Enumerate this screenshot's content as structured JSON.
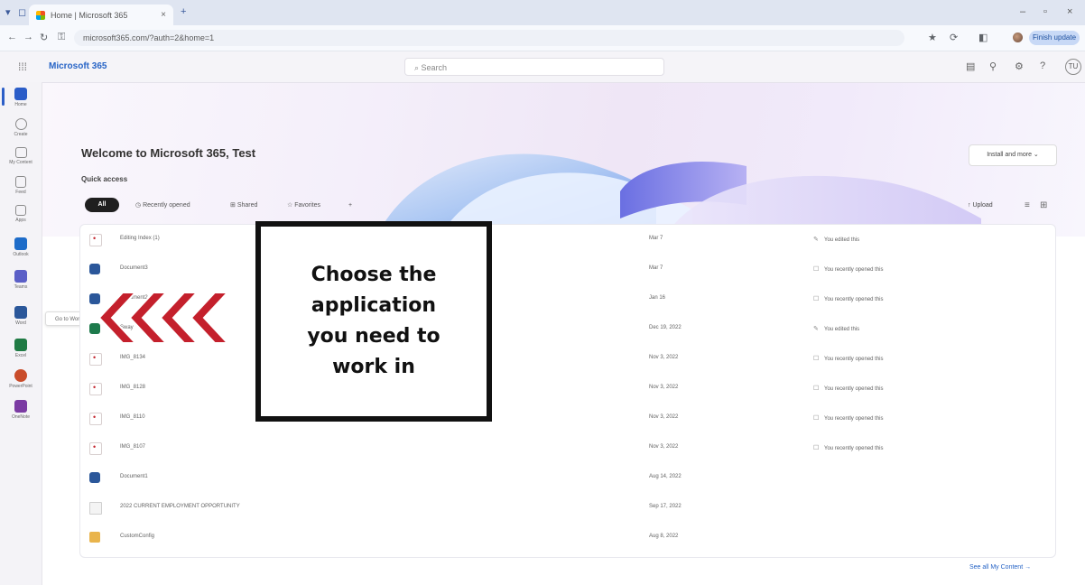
{
  "browser": {
    "tab_title": "Home | Microsoft 365",
    "tab_close": "×",
    "new_tab": "+",
    "url": "microsoft365.com/?auth=2&home=1",
    "update_label": "Finish update",
    "window_controls": [
      "–",
      "▫",
      "×"
    ]
  },
  "header": {
    "app_name": "Microsoft 365",
    "search_placeholder": "Search",
    "avatar_initials": "TU"
  },
  "rail": {
    "items": [
      {
        "label": "Home",
        "color": "#2b5dc8"
      },
      {
        "label": "Create",
        "color": "#7a7a7a"
      },
      {
        "label": "My Content",
        "color": "#7a7a7a"
      },
      {
        "label": "Feed",
        "color": "#7a7a7a"
      },
      {
        "label": "Apps",
        "color": "#7a7a7a"
      },
      {
        "label": "Outlook",
        "color": "#1d6cc9"
      },
      {
        "label": "Teams",
        "color": "#5b5fc7"
      },
      {
        "label": "Word",
        "color": "#2b579a"
      },
      {
        "label": "Excel",
        "color": "#1f7a44"
      },
      {
        "label": "PowerPoint",
        "color": "#c94c2a"
      },
      {
        "label": "OneNote",
        "color": "#7b3ba3"
      }
    ],
    "tooltip": "Go to Word"
  },
  "hero": {
    "welcome": "Welcome to Microsoft 365, Test",
    "install_label": "Install and more ⌄",
    "quick_access": "Quick access"
  },
  "filters": {
    "all": "All",
    "recent": "Recently opened",
    "shared": "Shared",
    "favorites": "Favorites",
    "more": "+",
    "upload": "Upload"
  },
  "files": [
    {
      "name": "Editing Index (1)",
      "date": "Mar 7",
      "activity": "You edited this",
      "type": "pdf",
      "act_icon": "✎"
    },
    {
      "name": "Document3",
      "date": "Mar 7",
      "activity": "You recently opened this",
      "type": "word",
      "act_icon": "☐"
    },
    {
      "name": "Document2",
      "date": "Jan 16",
      "activity": "You recently opened this",
      "type": "word",
      "act_icon": "☐"
    },
    {
      "name": "Sway",
      "date": "Dec 19, 2022",
      "activity": "You edited this",
      "type": "sway",
      "act_icon": "✎"
    },
    {
      "name": "IMG_8134",
      "date": "Nov 3, 2022",
      "activity": "You recently opened this",
      "type": "pdf",
      "act_icon": "☐"
    },
    {
      "name": "IMG_8128",
      "date": "Nov 3, 2022",
      "activity": "You recently opened this",
      "type": "pdf",
      "act_icon": "☐"
    },
    {
      "name": "IMG_8110",
      "date": "Nov 3, 2022",
      "activity": "You recently opened this",
      "type": "pdf",
      "act_icon": "☐"
    },
    {
      "name": "IMG_8107",
      "date": "Nov 3, 2022",
      "activity": "You recently opened this",
      "type": "pdf",
      "act_icon": "☐"
    },
    {
      "name": "Document1",
      "date": "Aug 14, 2022",
      "activity": "",
      "type": "word",
      "act_icon": ""
    },
    {
      "name": "2022 CURRENT EMPLOYMENT OPPORTUNITY",
      "date": "Sep 17, 2022",
      "activity": "",
      "type": "doc",
      "act_icon": ""
    },
    {
      "name": "CustomConfig",
      "date": "Aug 8, 2022",
      "activity": "",
      "type": "folder",
      "act_icon": ""
    }
  ],
  "see_all": "See all My Content →",
  "callout": {
    "text": "Choose the\napplication\nyou need to\nwork in"
  },
  "colors": {
    "accent": "#2764c6",
    "arrow": "#c4202c"
  }
}
